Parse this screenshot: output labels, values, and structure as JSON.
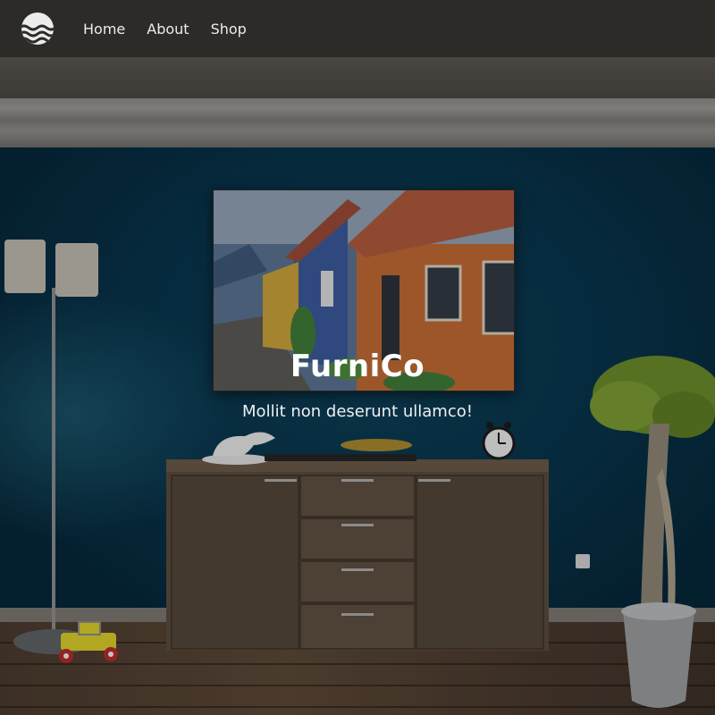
{
  "nav": {
    "logo_icon": "waves-logo-icon",
    "links": [
      {
        "label": "Home"
      },
      {
        "label": "About"
      },
      {
        "label": "Shop"
      }
    ]
  },
  "hero": {
    "title": "FurniCo",
    "subtitle": "Mollit non deserunt ullamco!"
  },
  "colors": {
    "navbar_bg": "#2d2b28",
    "wall": "#08334a",
    "text": "#ffffff"
  }
}
